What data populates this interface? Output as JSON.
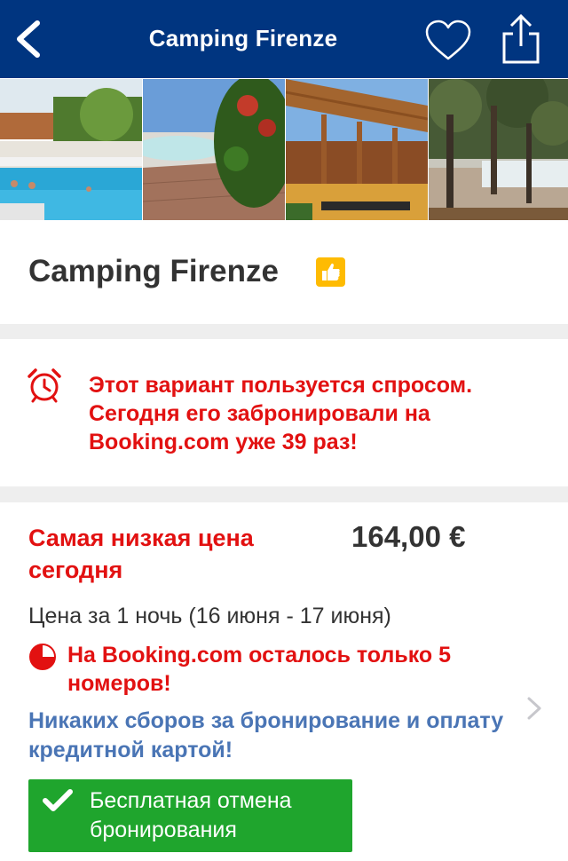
{
  "navbar": {
    "title": "Camping Firenze",
    "back_icon": "chevron-left-icon",
    "favorite_icon": "heart-outline-icon",
    "share_icon": "share-icon",
    "background": "#003580"
  },
  "gallery": {
    "photos": [
      "pool-photo",
      "beach-pool-photo",
      "pergola-terrace-photo",
      "olive-trees-photo"
    ]
  },
  "property": {
    "name": "Camping Firenze",
    "badge_icon": "thumbs-up-icon"
  },
  "demand_alert": {
    "icon": "alarm-clock-icon",
    "text": "Этот вариант пользуется спросом. Сегодня его забронировали на Booking.com уже 39 раз!"
  },
  "pricing": {
    "lowest_label": "Самая низкая цена сегодня",
    "price": "164,00 €",
    "per_night": "Цена за 1 ночь (16 июня - 17 июня)",
    "scarcity_icon": "pie-chart-icon",
    "rooms_left": "На Booking.com осталось только 5 номеров!",
    "no_fees": "Никаких сборов за бронирование и оплату кредитной картой!",
    "free_cancellation": "Бесплатная отмена бронирования"
  },
  "colors": {
    "brand": "#003580",
    "alert_red": "#e21111",
    "link_blue": "#4a75b5",
    "success_green": "#1fa52d",
    "badge_yellow": "#febb02"
  }
}
